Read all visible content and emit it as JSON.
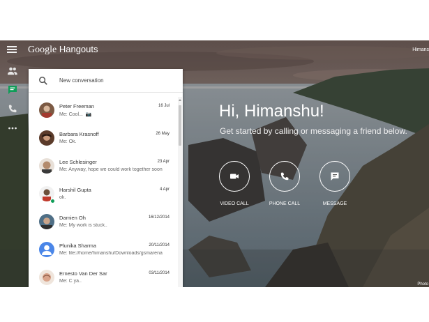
{
  "app": {
    "brand_google": "Google",
    "brand_product": "Hangouts",
    "user_name": "Himans"
  },
  "search": {
    "placeholder": "New conversation"
  },
  "conversations": [
    {
      "name": "Peter Freeman",
      "date": "16 Jul",
      "snippet": "Me: Cool...",
      "extra": "📷",
      "avatar_color": "#7c5a44",
      "online": false
    },
    {
      "name": "Barbara Krasnoff",
      "date": "26 May",
      "snippet": "Me: Ok.",
      "extra": "",
      "avatar_color": "#5b3b2a",
      "online": false
    },
    {
      "name": "Lee Schlesinger",
      "date": "23 Apr",
      "snippet": "Me: Anyway, hope we could work together soon",
      "extra": "",
      "avatar_color": "#b38b6d",
      "online": false
    },
    {
      "name": "Harshil Gupta",
      "date": "4 Apr",
      "snippet": "ok.",
      "extra": "",
      "avatar_color": "#6b4f3a",
      "online": true
    },
    {
      "name": "Damien Oh",
      "date": "16/12/2014",
      "snippet": "Me: My work is stuck..",
      "extra": "",
      "avatar_color": "#4f6f86",
      "online": false
    },
    {
      "name": "Plunika Sharma",
      "date": "20/11/2014",
      "snippet": "Me: file://home/himanshu/Downloads/gsmarena",
      "extra": "",
      "avatar_color": "#4a86e8",
      "online": false
    },
    {
      "name": "Ernesto Van Der Sar",
      "date": "03/11/2014",
      "snippet": "Me: C ya..",
      "extra": "",
      "avatar_color": "#d9a38a",
      "online": false
    }
  ],
  "welcome": {
    "greeting": "Hi, Himanshu!",
    "subtitle": "Get started by calling or messaging a friend below."
  },
  "actions": {
    "video": "VIDEO CALL",
    "phone": "PHONE CALL",
    "message": "MESSAGE"
  },
  "credit": "Photo",
  "colors": {
    "accent_green": "#0f9d58",
    "rail_icon": "#e6e6e6"
  },
  "icons": {
    "menu": "hamburger-icon",
    "contacts": "people-icon",
    "messages": "chat-icon",
    "phone": "phone-icon",
    "more": "more-icon",
    "search": "search-icon",
    "video": "videocam-icon",
    "message": "message-icon"
  }
}
